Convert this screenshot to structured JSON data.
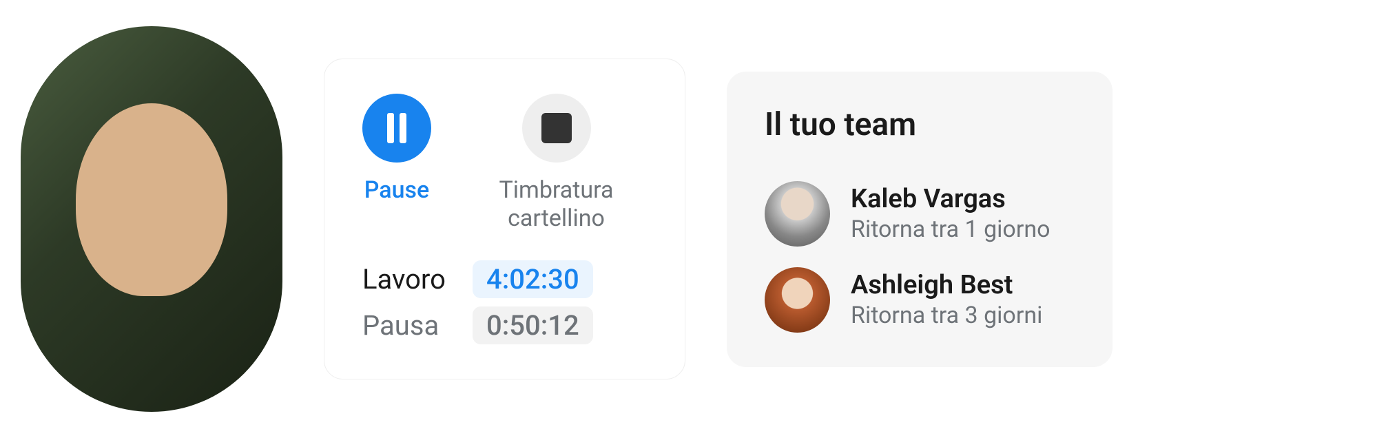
{
  "tracker": {
    "pause_label": "Pause",
    "clockout_label": "Timbratura cartellino",
    "rows": {
      "work": {
        "label": "Lavoro",
        "value": "4:02:30"
      },
      "break": {
        "label": "Pausa",
        "value": "0:50:12"
      }
    }
  },
  "team": {
    "title": "Il tuo team",
    "members": [
      {
        "name": "Kaleb Vargas",
        "status": "Ritorna tra 1 giorno"
      },
      {
        "name": "Ashleigh Best",
        "status": "Ritorna tra 3 giorni"
      }
    ]
  }
}
